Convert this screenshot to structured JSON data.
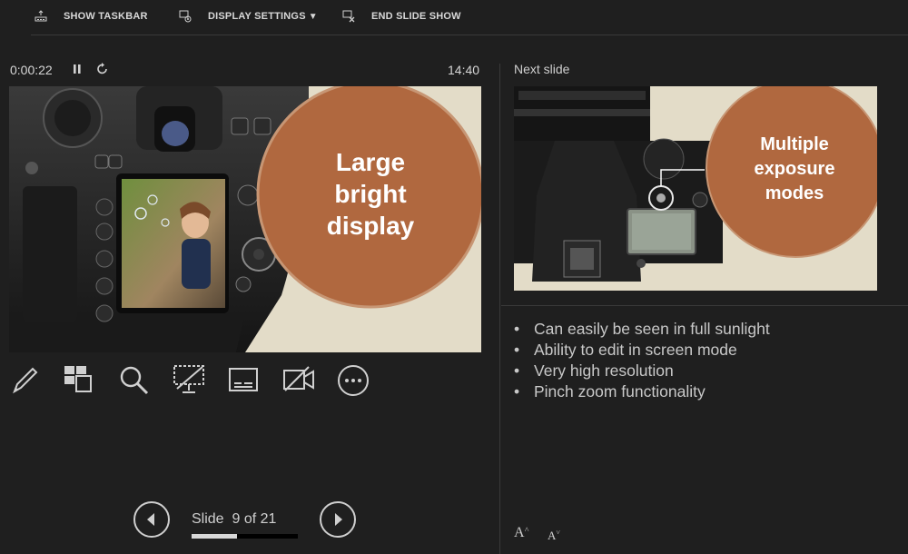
{
  "topbar": {
    "show_taskbar": "SHOW TASKBAR",
    "display_settings": "DISPLAY SETTINGS",
    "display_settings_caret": "▼",
    "end_slide_show": "END SLIDE SHOW"
  },
  "presenter": {
    "elapsed": "0:00:22",
    "clock": "14:40",
    "pause_icon": "pause-icon",
    "restart_icon": "restart-icon"
  },
  "current_slide": {
    "circle_text_lines": [
      "Large",
      "bright",
      "display"
    ],
    "circle_color": "#b0683f",
    "background": "#e3dcc8"
  },
  "next_slide": {
    "label": "Next slide",
    "circle_text_lines": [
      "Multiple",
      "exposure",
      "modes"
    ],
    "circle_color": "#b0683f"
  },
  "notes": {
    "bullets": [
      "Can easily be seen in full sunlight",
      "Ability to edit in screen mode",
      "Very high resolution",
      "Pinch zoom functionality"
    ]
  },
  "tools": [
    "pen-icon",
    "see-all-slides-icon",
    "zoom-icon",
    "black-screen-icon",
    "subtitles-icon",
    "camera-icon",
    "more-options-icon"
  ],
  "navigation": {
    "slide_word": "Slide",
    "slide_position": "9 of 21",
    "progress_fraction": 0.43
  },
  "font_controls": {
    "increase": "A",
    "decrease": "A"
  }
}
